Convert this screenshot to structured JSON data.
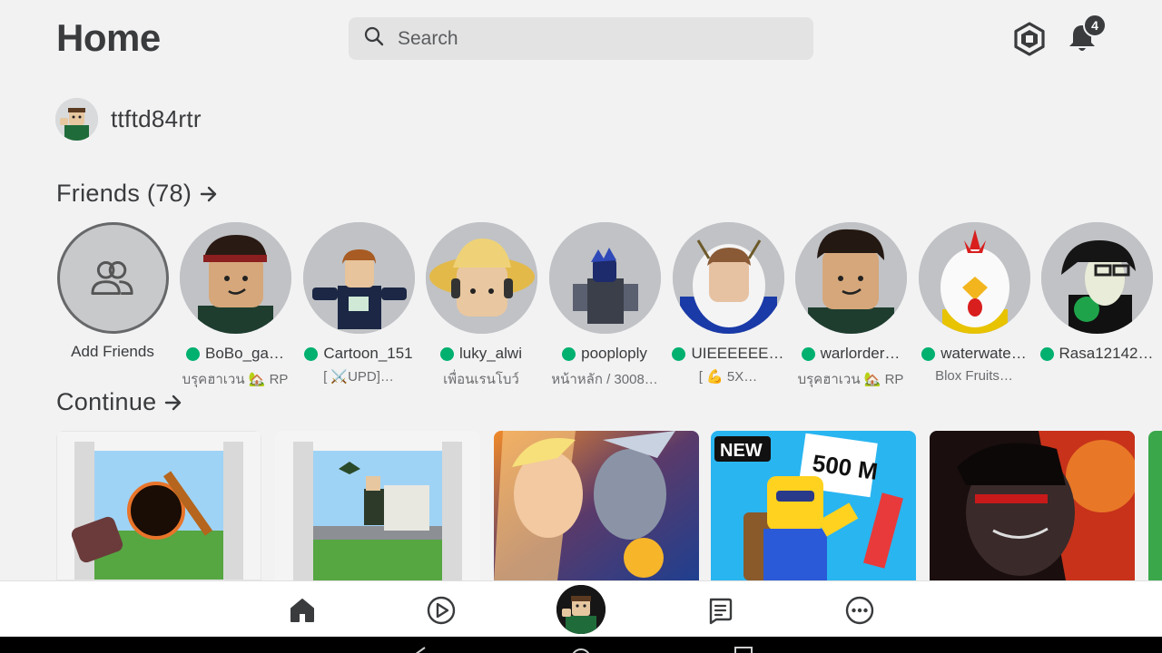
{
  "header": {
    "title": "Home",
    "search_placeholder": "Search",
    "notification_count": "4"
  },
  "profile": {
    "username": "ttftd84rtr"
  },
  "friends_section": {
    "title": "Friends (78)",
    "add_friends_label": "Add Friends",
    "items": [
      {
        "name": "BoBo_ga…",
        "status": "บรุคฮาเวน 🏡 RP",
        "online": true
      },
      {
        "name": "Cartoon_151",
        "status": "[ ⚔️UPD]…",
        "online": true
      },
      {
        "name": "luky_alwi",
        "status": "เพื่อนเรนโบว์",
        "online": true
      },
      {
        "name": "pooploply",
        "status": "หน้าหลัก / 3008…",
        "online": true
      },
      {
        "name": "UIEEEEEE…",
        "status": "[ 💪 5X…",
        "online": true
      },
      {
        "name": "warlorder…",
        "status": "บรุคฮาเวน 🏡 RP",
        "online": true
      },
      {
        "name": "waterwate…",
        "status": "Blox Fruits…",
        "online": true
      },
      {
        "name": "Rasa12142…",
        "status": "",
        "online": true
      }
    ]
  },
  "continue_section": {
    "title": "Continue",
    "games": [
      {
        "badge": ""
      },
      {
        "badge": ""
      },
      {
        "badge": ""
      },
      {
        "badge": "NEW",
        "overlay_text": "500 M"
      },
      {
        "badge": ""
      }
    ]
  },
  "colors": {
    "background": "#f2f2f3",
    "text": "#393b3d",
    "online": "#00b06f",
    "search_bg": "#e3e3e4"
  },
  "bottom_nav": {
    "items": [
      "home-icon",
      "play-icon",
      "avatar",
      "chat-icon",
      "more-icon"
    ]
  }
}
